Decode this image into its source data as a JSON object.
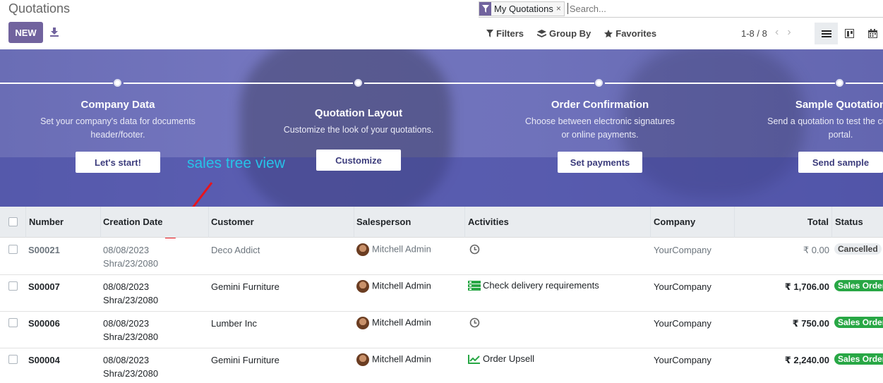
{
  "header": {
    "title": "Quotations",
    "new_label": "NEW"
  },
  "search": {
    "facet_label": "My Quotations",
    "facet_remove": "×",
    "placeholder": "Search..."
  },
  "toolbar": {
    "filters": "Filters",
    "group_by": "Group By",
    "favorites": "Favorites"
  },
  "pager": {
    "value": "1-8 / 8",
    "prev": "‹",
    "next": "›"
  },
  "banner": {
    "steps": [
      {
        "title": "Company Data",
        "desc1": "Set your company's data for documents",
        "desc2": "header/footer.",
        "button": "Let's start!"
      },
      {
        "title": "Quotation Layout",
        "desc1": "Customize the look of your quotations.",
        "desc2": "",
        "button": "Customize"
      },
      {
        "title": "Order Confirmation",
        "desc1": "Choose between electronic signatures",
        "desc2": "or online payments.",
        "button": "Set payments"
      },
      {
        "title": "Sample Quotation",
        "desc1": "Send a quotation to test the customer",
        "desc2": "portal.",
        "button": "Send sample"
      }
    ]
  },
  "annotation": {
    "text": "sales tree view",
    "color": "#27c3e8",
    "arrow_color": "#e8141c"
  },
  "table": {
    "columns": [
      "Number",
      "Creation Date",
      "Customer",
      "Salesperson",
      "Activities",
      "Company",
      "Total",
      "Status"
    ],
    "rows": [
      {
        "number": "S00021",
        "date": "08/08/2023",
        "date2": "Shra/23/2080",
        "customer": "Deco Addict",
        "salesperson": "Mitchell Admin",
        "activity_icon": "clock-icon",
        "activity": "",
        "company": "YourCompany",
        "total": "₹ 0.00",
        "status": "Cancelled",
        "muted": true
      },
      {
        "number": "S00007",
        "date": "08/08/2023",
        "date2": "Shra/23/2080",
        "customer": "Gemini Furniture",
        "salesperson": "Mitchell Admin",
        "activity_icon": "tasks-icon",
        "activity": "Check delivery requirements",
        "company": "YourCompany",
        "total": "₹ 1,706.00",
        "status": "Sales Order",
        "muted": false
      },
      {
        "number": "S00006",
        "date": "08/08/2023",
        "date2": "Shra/23/2080",
        "customer": "Lumber Inc",
        "salesperson": "Mitchell Admin",
        "activity_icon": "clock-icon",
        "activity": "",
        "company": "YourCompany",
        "total": "₹ 750.00",
        "status": "Sales Order",
        "muted": false
      },
      {
        "number": "S00004",
        "date": "08/08/2023",
        "date2": "Shra/23/2080",
        "customer": "Gemini Furniture",
        "salesperson": "Mitchell Admin",
        "activity_icon": "chart-line-icon",
        "activity": "Order Upsell",
        "company": "YourCompany",
        "total": "₹ 2,240.00",
        "status": "Sales Order",
        "muted": false
      }
    ]
  },
  "colors": {
    "brand": "#71639e",
    "success": "#28a745"
  }
}
